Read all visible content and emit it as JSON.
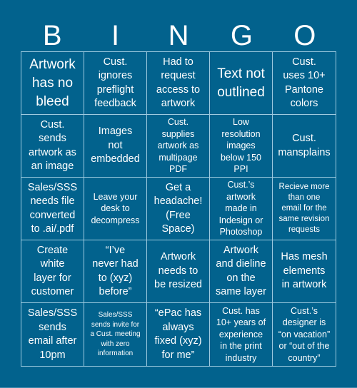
{
  "header": {
    "letters": [
      "B",
      "I",
      "N",
      "G",
      "O"
    ]
  },
  "colors": {
    "background": "#02628d",
    "grid_line": "#9ecbe0",
    "text": "#ffffff"
  },
  "board": {
    "cells": [
      "Artwork\nhas no\nbleed",
      "Cust.\nignores\npreflight\nfeedback",
      "Had to\nrequest\naccess to\nartwork",
      "Text not\noutlined",
      "Cust.\nuses 10+\nPantone\ncolors",
      "Cust.\nsends\nartwork as\nan image",
      "Images\nnot\nembedded",
      "Cust.\nsupplies\nartwork as\nmultipage\nPDF",
      "Low\nresolution\nimages\nbelow 150\nPPI",
      "Cust.\nmansplains",
      "Sales/SSS\nneeds file\nconverted\nto .ai/.pdf",
      "Leave your\ndesk to\ndecompress",
      "Get a\nheadache!\n(Free\nSpace)",
      "Cust.’s\nartwork\nmade in\nIndesign or\nPhotoshop",
      "Recieve more\nthan one\nemail for the\nsame revision\nrequests",
      "Create\nwhite\nlayer for\ncustomer",
      "“I’ve\nnever had\nto (xyz)\nbefore”",
      "Artwork\nneeds to\nbe resized",
      "Artwork\nand dieline\non the\nsame layer",
      "Has mesh\nelements\nin artwork",
      "Sales/SSS\nsends\nemail after\n10pm",
      "Sales/SSS\nsends invite for\na Cust. meeting\nwith zero\ninformation",
      "“ePac has\nalways\nfixed (xyz)\nfor me”",
      "Cust. has\n10+ years of\nexperience\nin the print\nindustry",
      "Cust.’s\ndesigner is\n“on vacation”\nor “out of the\ncountry”"
    ],
    "free_space_index": 12
  }
}
